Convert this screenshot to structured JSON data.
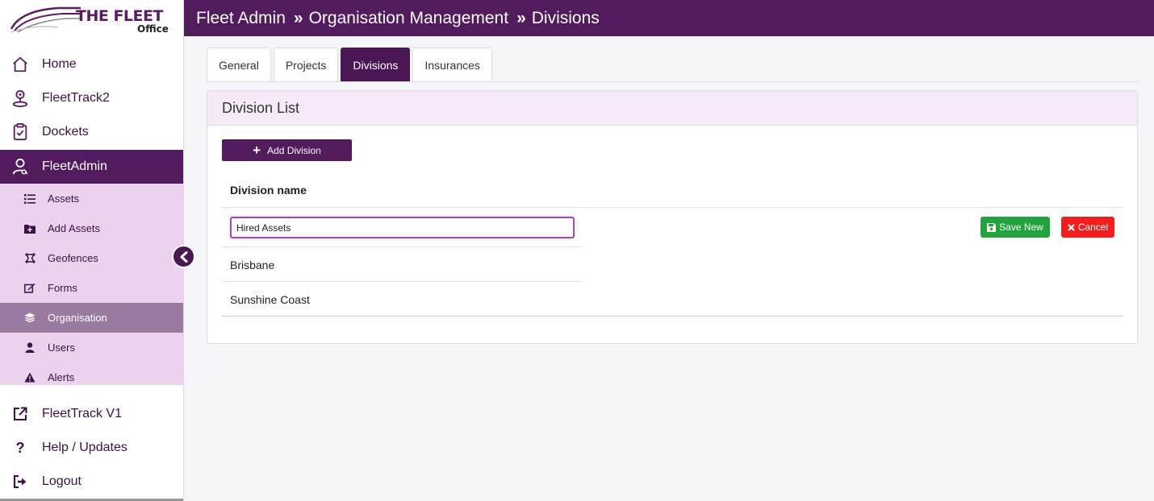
{
  "logo": {
    "line1": "THE FLEET",
    "line2": "Office"
  },
  "sidebar": {
    "items": [
      {
        "label": "Home",
        "icon": "home-icon"
      },
      {
        "label": "FleetTrack2",
        "icon": "location-person-icon"
      },
      {
        "label": "Dockets",
        "icon": "clipboard-check-icon"
      },
      {
        "label": "FleetAdmin",
        "icon": "admin-user-icon"
      }
    ],
    "subitems": [
      {
        "label": "Assets",
        "icon": "list-icon"
      },
      {
        "label": "Add Assets",
        "icon": "folder-plus-icon"
      },
      {
        "label": "Geofences",
        "icon": "geofence-icon"
      },
      {
        "label": "Forms",
        "icon": "edit-icon"
      },
      {
        "label": "Organisation",
        "icon": "layers-icon"
      },
      {
        "label": "Users",
        "icon": "user-icon"
      },
      {
        "label": "Alerts",
        "icon": "warning-icon"
      }
    ],
    "bottom_items": [
      {
        "label": "FleetTrack V1",
        "icon": "external-link-icon"
      },
      {
        "label": "Help / Updates",
        "icon": "question-icon"
      },
      {
        "label": "Logout",
        "icon": "logout-icon"
      }
    ]
  },
  "header": {
    "crumbs": [
      "Fleet Admin",
      "Organisation Management",
      "Divisions"
    ],
    "separator": "»"
  },
  "tabs": [
    "General",
    "Projects",
    "Divisions",
    "Insurances"
  ],
  "panel": {
    "title": "Division List",
    "add_label": "Add Division",
    "column_header": "Division name",
    "input_value": "Hired Assets",
    "save_label": "Save New",
    "cancel_label": "Cancel",
    "rows": [
      "Brisbane",
      "Sunshine Coast"
    ]
  },
  "colors": {
    "brand": "#521b5e",
    "submenu_bg": "#ebd3ee",
    "save": "#22a33b",
    "cancel": "#f21d1d"
  }
}
